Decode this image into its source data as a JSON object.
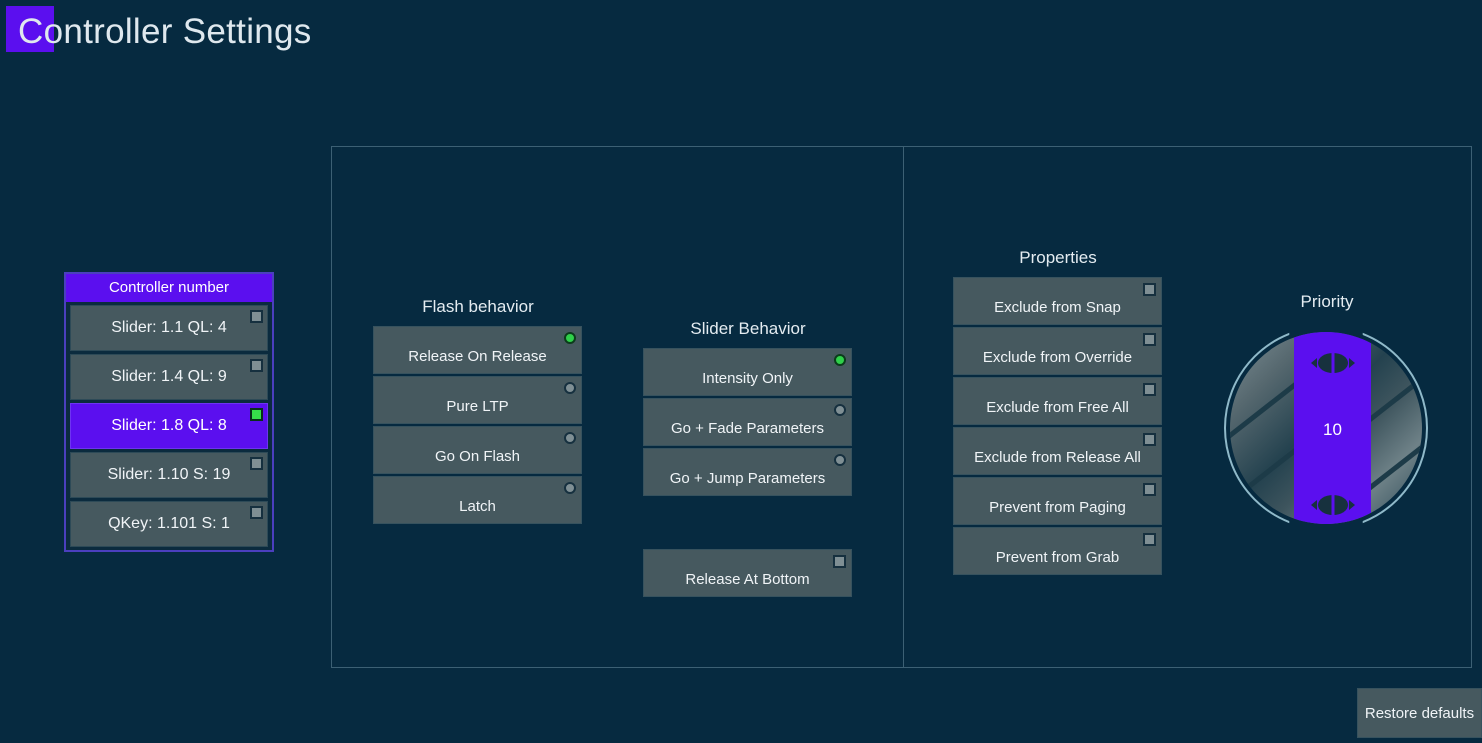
{
  "window": {
    "title": "Controller Settings",
    "background_color": "#062a40",
    "accent_color": "#5b0fef",
    "active_indicator_color": "#2fd04a"
  },
  "controller_list": {
    "header": "Controller number",
    "rows": [
      {
        "label": "Slider: 1.1 QL: 4",
        "selected": false
      },
      {
        "label": "Slider: 1.4 QL: 9",
        "selected": false
      },
      {
        "label": "Slider: 1.8 QL: 8",
        "selected": true
      },
      {
        "label": "Slider: 1.10 S: 19",
        "selected": false
      },
      {
        "label": "QKey: 1.101 S: 1",
        "selected": false
      }
    ]
  },
  "flash_behavior": {
    "title": "Flash behavior",
    "options": [
      {
        "label": "Release On Release",
        "active": true
      },
      {
        "label": "Pure LTP",
        "active": false
      },
      {
        "label": "Go On Flash",
        "active": false
      },
      {
        "label": "Latch",
        "active": false
      }
    ]
  },
  "slider_behavior": {
    "title": "Slider Behavior",
    "options": [
      {
        "label": "Intensity Only",
        "active": true
      },
      {
        "label": "Go + Fade Parameters",
        "active": false
      },
      {
        "label": "Go + Jump Parameters",
        "active": false
      }
    ],
    "toggle": {
      "label": "Release At Bottom",
      "checked": false
    }
  },
  "properties": {
    "title": "Properties",
    "items": [
      {
        "label": "Exclude from Snap",
        "checked": false
      },
      {
        "label": "Exclude from Override",
        "checked": false
      },
      {
        "label": "Exclude from Free All",
        "checked": false
      },
      {
        "label": "Exclude from Release All",
        "checked": false
      },
      {
        "label": "Prevent from Paging",
        "checked": false
      },
      {
        "label": "Prevent from Grab",
        "checked": false
      }
    ]
  },
  "priority": {
    "title": "Priority",
    "value": "10"
  },
  "footer": {
    "restore_defaults": "Restore defaults"
  }
}
